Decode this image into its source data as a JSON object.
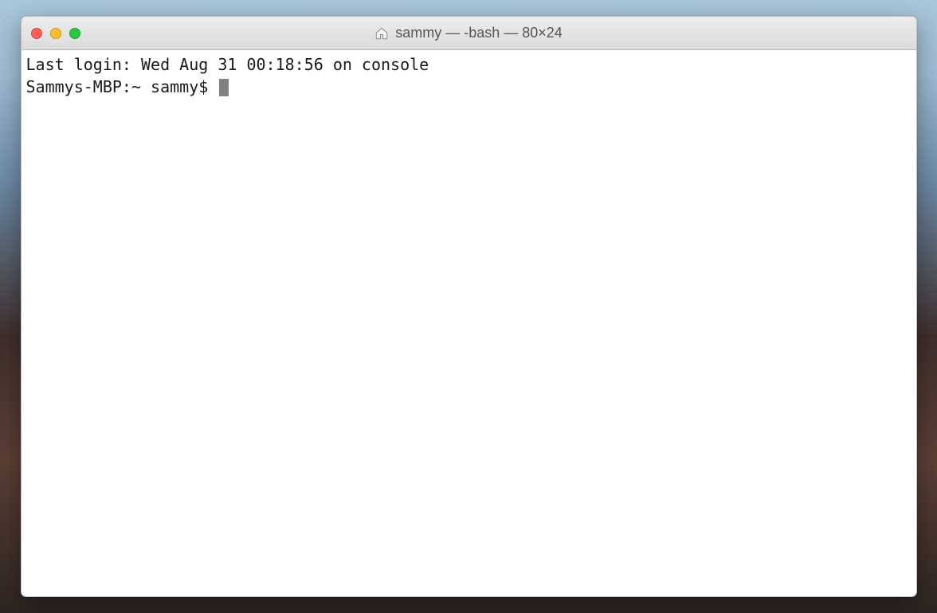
{
  "window": {
    "title": "sammy — -bash — 80×24"
  },
  "terminal": {
    "login_line": "Last login: Wed Aug 31 00:18:56 on console",
    "prompt": "Sammys-MBP:~ sammy$ "
  }
}
